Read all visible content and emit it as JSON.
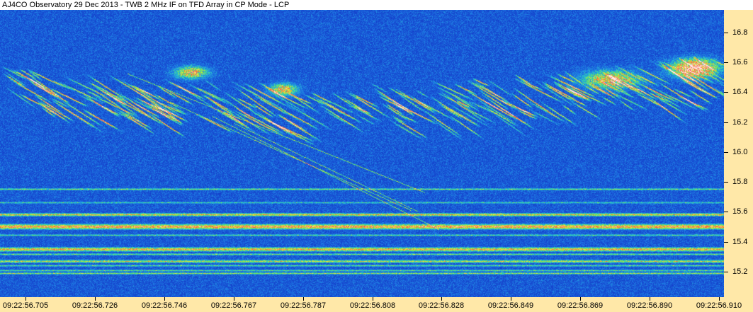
{
  "window": {
    "title": "AJ4CO Observatory 29 Dec 2013 - TWB 2 MHz IF on TFD Array in CP Mode - LCP"
  },
  "freq_axis": {
    "unit": "MHz",
    "range": [
      15.03,
      16.95
    ],
    "ticks": [
      "16.8",
      "16.6",
      "16.4",
      "16.2",
      "16.0",
      "15.8",
      "15.6",
      "15.4",
      "15.2"
    ]
  },
  "time_axis": {
    "ticks": [
      "09:22:56.705",
      "09:22:56.726",
      "09:22:56.746",
      "09:22:56.767",
      "09:22:56.787",
      "09:22:56.808",
      "09:22:56.828",
      "09:22:56.849",
      "09:22:56.869",
      "09:22:56.890",
      "09:22:56.910"
    ]
  },
  "colors": {
    "background_noise": "#1a3fbf",
    "axis_background": "#ffe8a8",
    "emission_hot": "#ffcc66"
  }
}
